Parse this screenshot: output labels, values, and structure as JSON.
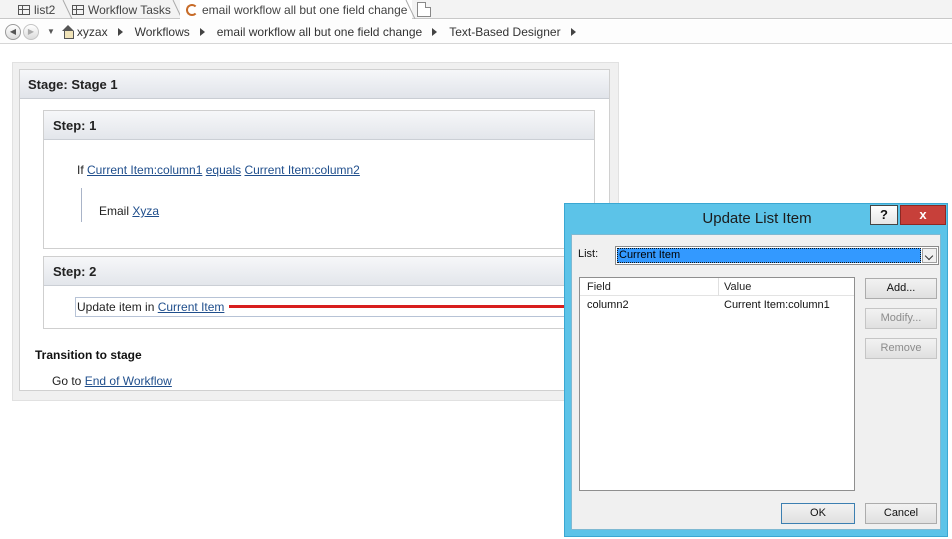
{
  "tabs": [
    {
      "label": "list2",
      "icon": "list-icon"
    },
    {
      "label": "Workflow Tasks",
      "icon": "list-icon"
    },
    {
      "label": "email workflow all but one field change",
      "icon": "workflow-icon"
    }
  ],
  "breadcrumb": [
    "xyzax",
    "Workflows",
    "email workflow all but one field change",
    "Text-Based Designer"
  ],
  "designer": {
    "stage_title": "Stage: Stage 1",
    "step1": {
      "title": "Step: 1",
      "if_word": "If",
      "cond_left": "Current Item:column1",
      "cond_op": "equals",
      "cond_right": "Current Item:column2",
      "email_word": "Email",
      "email_to": "Xyza"
    },
    "step2": {
      "title": "Step: 2",
      "action_text": "Update item in",
      "action_link": "Current Item"
    },
    "transition_title": "Transition to stage",
    "goto_word": "Go to",
    "goto_link": "End of Workflow"
  },
  "dialog": {
    "title": "Update List Item",
    "help_label": "?",
    "close_label": "x",
    "list_label": "List:",
    "list_value": "Current Item",
    "columns": {
      "field": "Field",
      "value": "Value"
    },
    "rows": [
      {
        "field": "column2",
        "value": "Current Item:column1"
      }
    ],
    "buttons": {
      "add": "Add...",
      "modify": "Modify...",
      "remove": "Remove",
      "ok": "OK",
      "cancel": "Cancel"
    }
  }
}
